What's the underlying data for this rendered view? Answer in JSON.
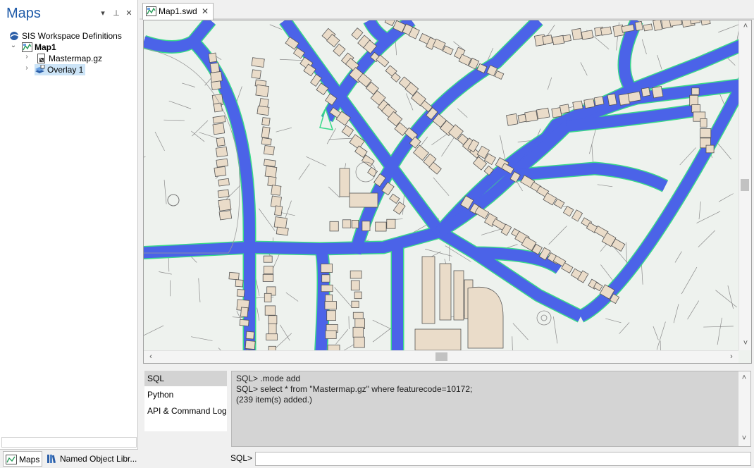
{
  "maps_panel": {
    "title": "Maps",
    "controls": {
      "dropdown": "▾",
      "pin": "⊥",
      "close": "✕"
    },
    "tree": {
      "root_label": "SIS Workspace Definitions",
      "map_label": "Map1",
      "items": [
        {
          "label": "Mastermap.gz",
          "icon": "mastermap-file-icon"
        },
        {
          "label": "Overlay 1",
          "icon": "overlay-icon",
          "selected": true
        }
      ]
    },
    "bottom_tabs": [
      {
        "label": "Maps",
        "icon": "maps-icon",
        "active": true
      },
      {
        "label": "Named Object Libr...",
        "icon": "library-icon",
        "active": false
      }
    ]
  },
  "document": {
    "tab_label": "Map1.swd",
    "tab_close": "✕"
  },
  "map": {
    "road_fill_color": "#4b63e8",
    "road_edge_color": "#39d98a",
    "background_color": "#eef2ee",
    "building_fill_color": "#eadcc9",
    "building_stroke_color": "#555555",
    "parcel_line_color": "#8a8a8a"
  },
  "console": {
    "modes": [
      {
        "label": "SQL",
        "active": true
      },
      {
        "label": "Python",
        "active": false
      },
      {
        "label": "API & Command Log",
        "active": false
      }
    ],
    "output_lines": [
      "SQL> .mode add",
      "SQL> select * from \"Mastermap.gz\" where featurecode=10172;",
      "(239 item(s) added.)"
    ],
    "prompt_label": "SQL>",
    "input_value": ""
  }
}
